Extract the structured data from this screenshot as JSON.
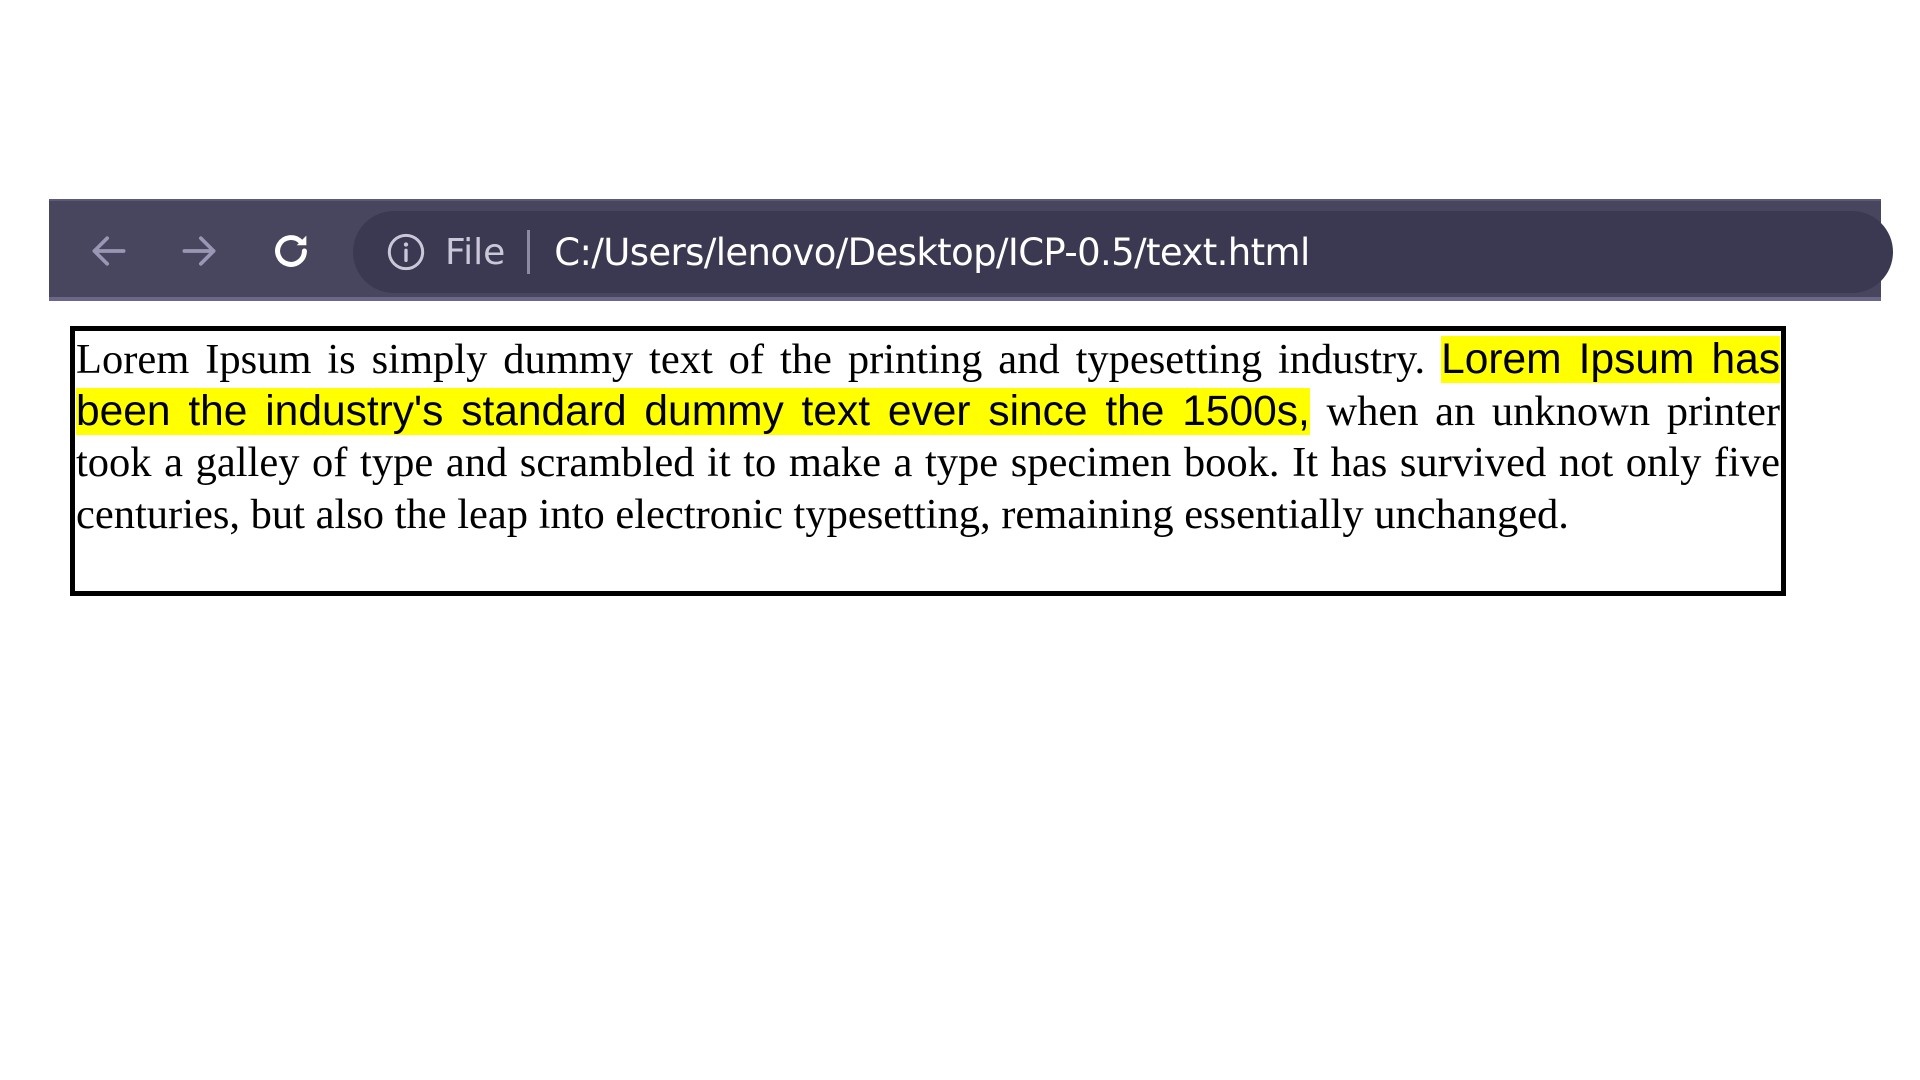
{
  "toolbar": {
    "back_icon": "arrow-left-icon",
    "forward_icon": "arrow-right-icon",
    "reload_icon": "reload-icon",
    "info_icon": "info-circle-icon",
    "scheme_label": "File",
    "url": "C:/Users/lenovo/Desktop/ICP-0.5/text.html",
    "colors": {
      "toolbar_bg": "#48455f",
      "omnibox_bg": "#3b3852",
      "url_text": "#ffffff",
      "dim_icon": "#9a97b5"
    }
  },
  "content": {
    "text_before": "Lorem Ipsum is simply dummy text of the printing and typesetting industry. ",
    "highlighted_text": "Lorem Ipsum has been the industry's standard dummy text ever since the 1500s,",
    "text_after": " when an unknown printer took a galley of type and scrambled it to make a type specimen book. It has survived not only five centuries, but also the leap into electronic typesetting, remaining essentially unchanged.",
    "highlight_color": "#ffff00",
    "border_color": "#000000"
  }
}
